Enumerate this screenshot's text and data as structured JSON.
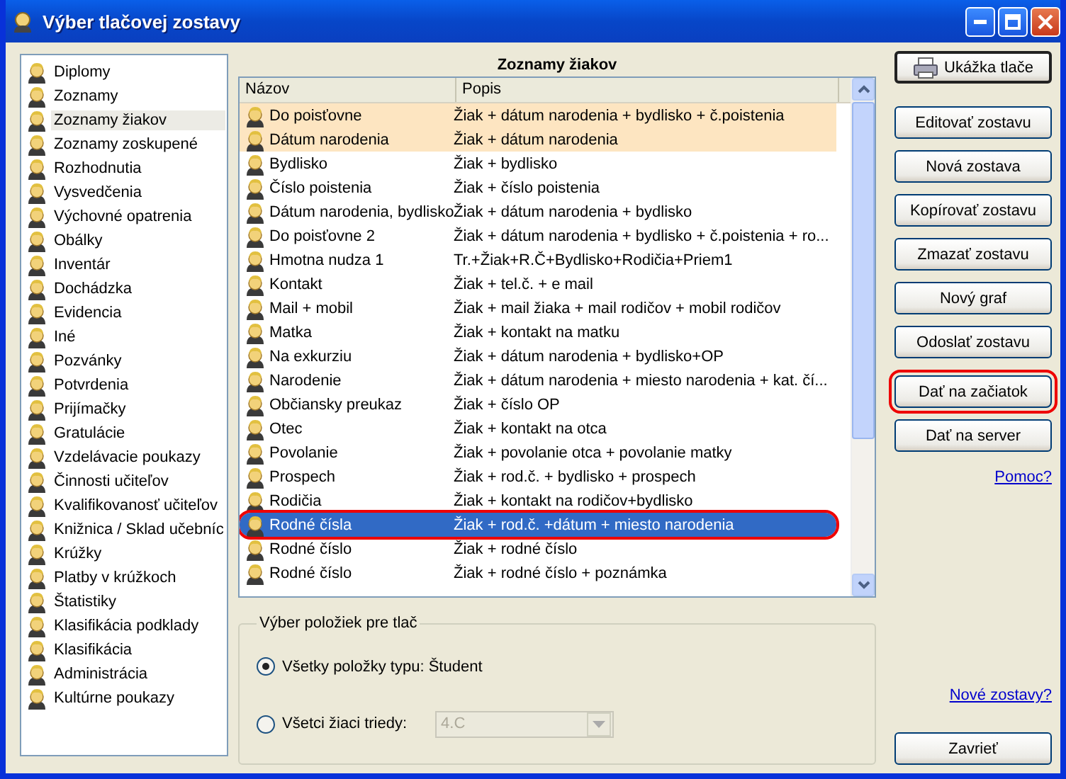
{
  "window": {
    "title": "Výber tlačovej zostavy"
  },
  "sidebar": {
    "items": [
      {
        "label": "Diplomy",
        "selected": false
      },
      {
        "label": "Zoznamy",
        "selected": false
      },
      {
        "label": "Zoznamy žiakov",
        "selected": true
      },
      {
        "label": "Zoznamy zoskupené",
        "selected": false
      },
      {
        "label": "Rozhodnutia",
        "selected": false
      },
      {
        "label": "Vysvedčenia",
        "selected": false
      },
      {
        "label": "Výchovné opatrenia",
        "selected": false
      },
      {
        "label": "Obálky",
        "selected": false
      },
      {
        "label": "Inventár",
        "selected": false
      },
      {
        "label": "Dochádzka",
        "selected": false
      },
      {
        "label": "Evidencia",
        "selected": false
      },
      {
        "label": "Iné",
        "selected": false
      },
      {
        "label": "Pozvánky",
        "selected": false
      },
      {
        "label": "Potvrdenia",
        "selected": false
      },
      {
        "label": "Prijímačky",
        "selected": false
      },
      {
        "label": "Gratulácie",
        "selected": false
      },
      {
        "label": "Vzdelávacie poukazy",
        "selected": false
      },
      {
        "label": "Činnosti učiteľov",
        "selected": false
      },
      {
        "label": "Kvalifikovanosť učiteľov",
        "selected": false
      },
      {
        "label": "Knižnica / Sklad učebníc",
        "selected": false
      },
      {
        "label": "Krúžky",
        "selected": false
      },
      {
        "label": "Platby v krúžkoch",
        "selected": false
      },
      {
        "label": "Štatistiky",
        "selected": false
      },
      {
        "label": "Klasifikácia podklady",
        "selected": false
      },
      {
        "label": "Klasifikácia",
        "selected": false
      },
      {
        "label": "Administrácia",
        "selected": false
      },
      {
        "label": "Kultúrne poukazy",
        "selected": false
      }
    ]
  },
  "list": {
    "title": "Zoznamy žiakov",
    "columns": [
      "Názov",
      "Popis"
    ],
    "rows": [
      {
        "name": "Do poisťovne",
        "description": "Žiak + dátum narodenia + bydlisko + č.poistenia",
        "highlighted": true,
        "selected": false,
        "annotated": false
      },
      {
        "name": "Dátum narodenia",
        "description": "Žiak + dátum narodenia",
        "highlighted": true,
        "selected": false,
        "annotated": false
      },
      {
        "name": "Bydlisko",
        "description": "Žiak + bydlisko",
        "highlighted": false,
        "selected": false,
        "annotated": false
      },
      {
        "name": "Číslo poistenia",
        "description": "Žiak + číslo poistenia",
        "highlighted": false,
        "selected": false,
        "annotated": false
      },
      {
        "name": "Dátum narodenia, bydlisko",
        "description": "Žiak + dátum narodenia + bydlisko",
        "highlighted": false,
        "selected": false,
        "annotated": false
      },
      {
        "name": "Do poisťovne 2",
        "description": "Žiak + dátum narodenia + bydlisko + č.poistenia + ro...",
        "highlighted": false,
        "selected": false,
        "annotated": false
      },
      {
        "name": "Hmotna nudza 1",
        "description": "Tr.+Žiak+R.Č+Bydlisko+Rodičia+Priem1",
        "highlighted": false,
        "selected": false,
        "annotated": false
      },
      {
        "name": "Kontakt",
        "description": "Žiak + tel.č. + e mail",
        "highlighted": false,
        "selected": false,
        "annotated": false
      },
      {
        "name": "Mail + mobil",
        "description": "Žiak + mail žiaka + mail rodičov + mobil rodičov",
        "highlighted": false,
        "selected": false,
        "annotated": false
      },
      {
        "name": "Matka",
        "description": "Žiak + kontakt na matku",
        "highlighted": false,
        "selected": false,
        "annotated": false
      },
      {
        "name": "Na exkurziu",
        "description": "Žiak + dátum narodenia + bydlisko+OP",
        "highlighted": false,
        "selected": false,
        "annotated": false
      },
      {
        "name": "Narodenie",
        "description": "Žiak + dátum narodenia + miesto narodenia + kat. čí...",
        "highlighted": false,
        "selected": false,
        "annotated": false
      },
      {
        "name": "Občiansky preukaz",
        "description": "Žiak + číslo OP",
        "highlighted": false,
        "selected": false,
        "annotated": false
      },
      {
        "name": "Otec",
        "description": "Žiak + kontakt na otca",
        "highlighted": false,
        "selected": false,
        "annotated": false
      },
      {
        "name": "Povolanie",
        "description": "Žiak + povolanie otca + povolanie matky",
        "highlighted": false,
        "selected": false,
        "annotated": false
      },
      {
        "name": "Prospech",
        "description": "Žiak + rod.č. + bydlisko + prospech",
        "highlighted": false,
        "selected": false,
        "annotated": false
      },
      {
        "name": "Rodičia",
        "description": "Žiak + kontakt na rodičov+bydlisko",
        "highlighted": false,
        "selected": false,
        "annotated": false
      },
      {
        "name": "Rodné čísla",
        "description": "Žiak + rod.č. +dátum + miesto narodenia",
        "highlighted": false,
        "selected": true,
        "annotated": true
      },
      {
        "name": "Rodné číslo",
        "description": "Žiak + rodné číslo",
        "highlighted": false,
        "selected": false,
        "annotated": false
      },
      {
        "name": "Rodné číslo",
        "description": "Žiak + rodné číslo + poznámka",
        "highlighted": false,
        "selected": false,
        "annotated": false
      }
    ]
  },
  "print_selection": {
    "title": "Výber položiek pre tlač",
    "options": [
      {
        "label": "Všetky položky typu: Študent",
        "selected": true
      },
      {
        "label": "Všetci žiaci triedy:",
        "selected": false
      }
    ],
    "class_dropdown": {
      "value": "4.C",
      "disabled": true
    }
  },
  "actions": [
    {
      "label": "Ukážka tlače",
      "kind": "button",
      "default": true,
      "annotated": false
    },
    {
      "label": "Editovať zostavu",
      "kind": "button",
      "default": false,
      "annotated": false
    },
    {
      "label": "Nová zostava",
      "kind": "button",
      "default": false,
      "annotated": false
    },
    {
      "label": "Kopírovať zostavu",
      "kind": "button",
      "default": false,
      "annotated": false
    },
    {
      "label": "Zmazať zostavu",
      "kind": "button",
      "default": false,
      "annotated": false
    },
    {
      "label": "Nový graf",
      "kind": "button",
      "default": false,
      "annotated": false
    },
    {
      "label": "Odoslať zostavu",
      "kind": "button",
      "default": false,
      "annotated": false
    },
    {
      "label": "Dať na začiatok",
      "kind": "button",
      "default": false,
      "annotated": true
    },
    {
      "label": "Dať na server",
      "kind": "button",
      "default": false,
      "annotated": false
    },
    {
      "label": "Pomoc?",
      "kind": "link",
      "default": false,
      "annotated": false
    },
    {
      "label": "Nové zostavy?",
      "kind": "link",
      "default": false,
      "annotated": false
    },
    {
      "label": "Zavrieť",
      "kind": "button",
      "default": false,
      "annotated": false
    }
  ]
}
